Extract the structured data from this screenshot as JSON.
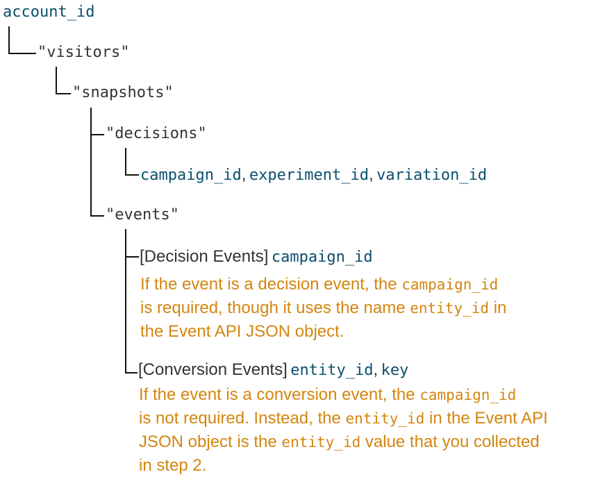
{
  "tree": {
    "root": "account_id",
    "visitors": "\"visitors\"",
    "snapshots": "\"snapshots\"",
    "decisions": "\"decisions\"",
    "decision_fields": {
      "f1": "campaign_id",
      "sep1": ",",
      "f2": "experiment_id",
      "sep2": ",",
      "f3": "variation_id"
    },
    "events": "\"events\"",
    "decision_events": {
      "label": "[Decision Events]",
      "field": "campaign_id",
      "note": {
        "l1_a": "If the event is a decision event, the ",
        "l1_code": "campaign_id",
        "l2_a": "is required, though it uses the name ",
        "l2_code": "entity_id",
        "l2_b": " in",
        "l3": "the Event API JSON object."
      }
    },
    "conversion_events": {
      "label": "[Conversion Events]",
      "field1": "entity_id",
      "sep": ",",
      "field2": "key",
      "note": {
        "l1_a": "If the event is a conversion event, the ",
        "l1_code": "campaign_id",
        "l2_a": "is not required. Instead, the ",
        "l2_code": "entity_id",
        "l2_b": " in the Event API",
        "l3_a": "JSON object is the ",
        "l3_code": "entity_id",
        "l3_b": " value that you collected",
        "l4": "in step 2."
      }
    }
  },
  "colors": {
    "key": "#0b4f6c",
    "text": "#333333",
    "note": "#d4850f",
    "connector": "#111111"
  }
}
